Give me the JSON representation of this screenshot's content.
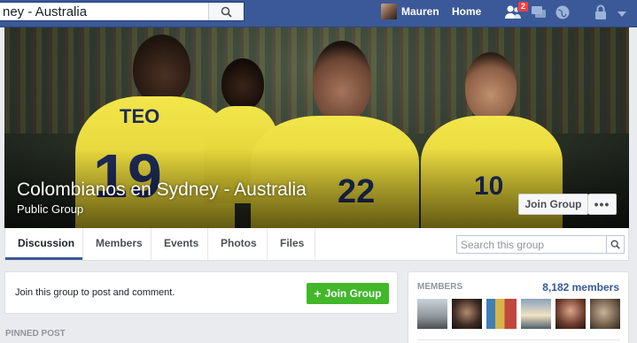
{
  "topbar": {
    "search_value": "ney - Australia",
    "user_name": "Mauren",
    "home_label": "Home",
    "friend_requests_badge": "2"
  },
  "cover": {
    "title": "Colombianos en Sydney - Australia",
    "privacy": "Public Group",
    "join_label": "Join Group",
    "more_label": "•••",
    "jersey_numbers": [
      "19",
      "22",
      "10"
    ],
    "jersey_name": "TEO"
  },
  "tabs": [
    "Discussion",
    "Members",
    "Events",
    "Photos",
    "Files"
  ],
  "group_search": {
    "placeholder": "Search this group"
  },
  "join_card": {
    "prompt": "Join this group to post and comment.",
    "button_label": "Join Group"
  },
  "pinned": {
    "label": "PINNED POST"
  },
  "members": {
    "title": "MEMBERS",
    "count": "8,182 members"
  },
  "colors": {
    "brand_blue": "#3b5998",
    "join_green": "#42b72a",
    "link_blue": "#365899"
  }
}
